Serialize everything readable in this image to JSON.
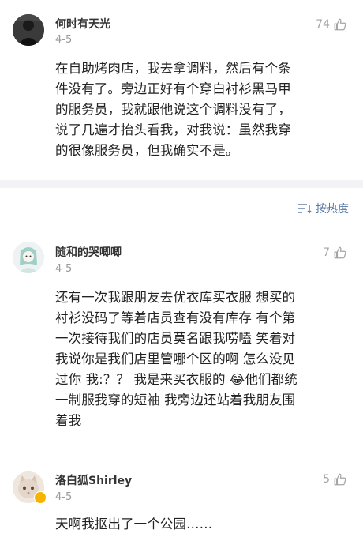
{
  "comments": [
    {
      "username": "何时有天光",
      "date": "4-5",
      "likes": "74",
      "lines": [
        "在自助烤肉店，我去拿调料，然后有个条",
        "件没有了。旁边正好有个穿白衬衫黑马甲",
        "的服务员，我就跟他说这个调料没有了，",
        "说了几遍才抬头看我，对我说：虽然我穿",
        "的很像服务员，但我确实不是。"
      ]
    },
    {
      "username": "随和的哭唧唧",
      "date": "4-5",
      "likes": "7",
      "lines": [
        "还有一次我跟朋友去优衣库买衣服 想买的",
        "衬衫没码了等着店员查有没有库存 有个第",
        "一次接待我们的店员莫名跟我唠嗑 笑着对",
        "我说你是我们店里管哪个区的啊 怎么没见",
        "过你 我:？？ 我是来买衣服的",
        "一制服我穿的短袖 我旁边还站着我朋友围",
        "着我"
      ],
      "emoji_after_line5": "他们都统",
      "emoji": "😂"
    },
    {
      "username": "洛白狐Shirley",
      "date": "4-5",
      "likes": "5",
      "lines": [
        "天啊我抠出了一个公园……"
      ]
    }
  ],
  "sort": {
    "label": "按热度"
  },
  "colors": {
    "link": "#5677a6",
    "muted": "#a5a5a5",
    "divider": "#f3f3f5"
  }
}
